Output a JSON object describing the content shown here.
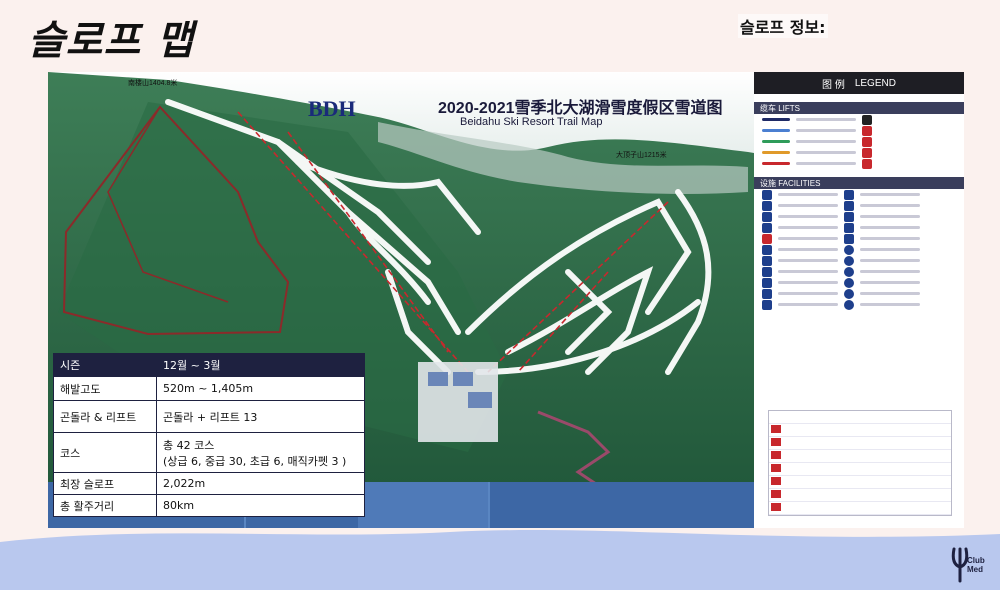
{
  "page": {
    "title": "슬로프 맵",
    "section_heading": "슬로프 정보:"
  },
  "map": {
    "logo": "BDH",
    "title_cn": "2020-2021雪季北大湖滑雪度假区雪道图",
    "title_en": "Beidahu Ski Resort Trail Map",
    "legend_title_cn": "图 例",
    "legend_title_en": "LEGEND",
    "legend_lifts": "缆车 LIFTS",
    "legend_facilities": "设施 FACILITIES",
    "peak_left": "南楼山1404.8米",
    "peak_right": "大顶子山1215米"
  },
  "info": {
    "header": {
      "label": "시즌",
      "value": "12월 ~ 3월"
    },
    "rows": [
      {
        "label": "해발고도",
        "value": "520m ~ 1,405m"
      },
      {
        "label": "곤돌라 & 리프트",
        "value": "곤돌라 + 리프트 13"
      },
      {
        "label": "코스",
        "value": "총 42 코스",
        "value2": "(상급 6, 중급 30, 초급 6, 매직카펫 3 )"
      },
      {
        "label": "최장 슬로프",
        "value": "2,022m"
      },
      {
        "label": "총 활주거리",
        "value": "80km"
      }
    ]
  },
  "brand": {
    "line1": "Club",
    "line2": "Med"
  },
  "colors": {
    "background": "#fbf1ee",
    "wave": "#b9c8ee",
    "table_header": "#1e2140",
    "forest": "#2e6b46",
    "trail": "#ffffff",
    "lift": "#c8282d"
  }
}
